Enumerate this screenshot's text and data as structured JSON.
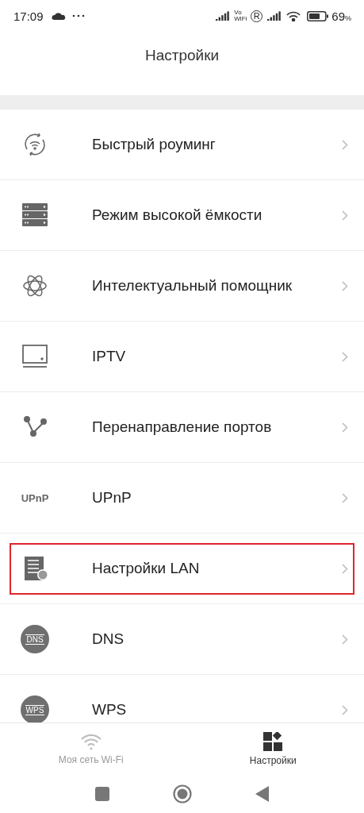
{
  "status_bar": {
    "time": "17:09",
    "volte_top": "Vo",
    "volte_bottom": "WiFi",
    "roaming": "R",
    "battery": "69",
    "battery_unit": "%"
  },
  "header": {
    "title": "Настройки"
  },
  "items": [
    {
      "label": "Быстрый роуминг",
      "kind": "roaming",
      "highlighted": false
    },
    {
      "label": "Режим высокой ёмкости",
      "kind": "server",
      "highlighted": false
    },
    {
      "label": "Интелектуальный помощник",
      "kind": "atom",
      "highlighted": false
    },
    {
      "label": "IPTV",
      "kind": "tv",
      "highlighted": false
    },
    {
      "label": "Перенаправление портов",
      "kind": "ports",
      "highlighted": false
    },
    {
      "label": "UPnP",
      "kind": "upnp",
      "icon_text": "UPnP",
      "highlighted": false
    },
    {
      "label": "Настройки LAN",
      "kind": "dhcp",
      "highlighted": true
    },
    {
      "label": "DNS",
      "kind": "badge",
      "icon_text": "DNS",
      "highlighted": false
    },
    {
      "label": "WPS",
      "kind": "badge",
      "icon_text": "WPS",
      "highlighted": false
    }
  ],
  "bottom_nav": [
    {
      "label": "Моя сеть Wi-Fi",
      "kind": "wifi",
      "selected": false
    },
    {
      "label": "Настройки",
      "kind": "tiles",
      "selected": true
    }
  ]
}
